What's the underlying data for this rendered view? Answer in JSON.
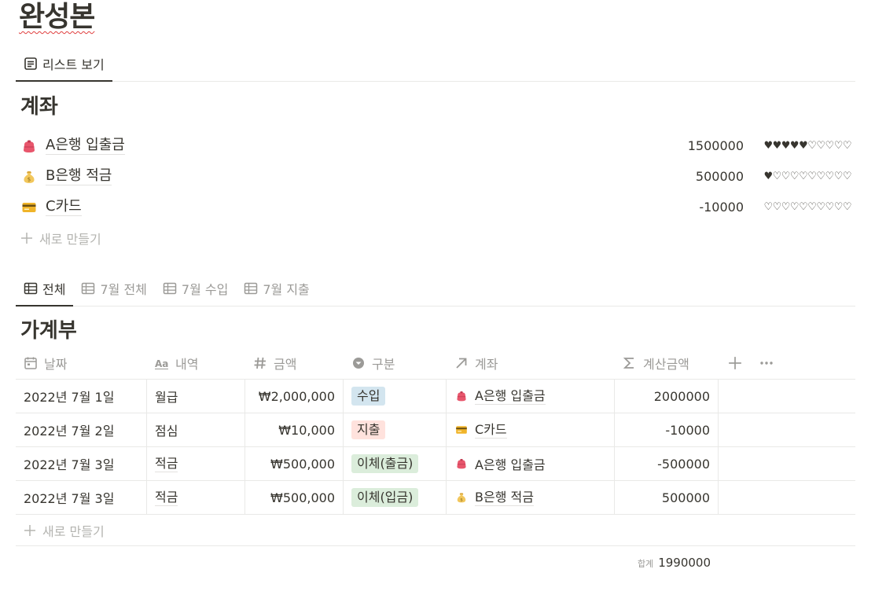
{
  "page": {
    "title": "완성본"
  },
  "top_tabs": [
    {
      "label": "리스트 보기",
      "icon": "list-view-icon",
      "active": true
    }
  ],
  "accounts_section": {
    "title": "계좌",
    "items": [
      {
        "icon": "purse-icon",
        "name": "A은행 입출금",
        "amount": "1500000",
        "hearts": "♥♥♥♥♥♡♡♡♡♡"
      },
      {
        "icon": "money-bag-icon",
        "name": "B은행 적금",
        "amount": "500000",
        "hearts": "♥♡♡♡♡♡♡♡♡♡"
      },
      {
        "icon": "credit-card-icon",
        "name": "C카드",
        "amount": "-10000",
        "hearts": "♡♡♡♡♡♡♡♡♡♡"
      }
    ],
    "new_label": "새로 만들기"
  },
  "view_tabs": [
    {
      "label": "전체",
      "active": true
    },
    {
      "label": "7월 전체",
      "active": false
    },
    {
      "label": "7월 수입",
      "active": false
    },
    {
      "label": "7월 지출",
      "active": false
    }
  ],
  "ledger": {
    "title": "가계부",
    "columns": [
      {
        "label": "날짜",
        "icon": "calendar-icon"
      },
      {
        "label": "내역",
        "icon": "text-icon"
      },
      {
        "label": "금액",
        "icon": "number-icon"
      },
      {
        "label": "구분",
        "icon": "select-icon"
      },
      {
        "label": "계좌",
        "icon": "relation-icon"
      },
      {
        "label": "계산금액",
        "icon": "formula-icon"
      }
    ],
    "rows": [
      {
        "date": "2022년 7월 1일",
        "item": "월급",
        "amount": "₩2,000,000",
        "category": "수입",
        "category_bg": "#d3e5ef",
        "account": "A은행 입출금",
        "account_icon": "purse-icon",
        "calc": "2000000"
      },
      {
        "date": "2022년 7월 2일",
        "item": "점심",
        "amount": "₩10,000",
        "category": "지출",
        "category_bg": "#ffe2dd",
        "account": "C카드",
        "account_icon": "credit-card-icon",
        "calc": "-10000"
      },
      {
        "date": "2022년 7월 3일",
        "item": "적금",
        "amount": "₩500,000",
        "category": "이체(출금)",
        "category_bg": "#dbeddb",
        "account": "A은행 입출금",
        "account_icon": "purse-icon",
        "calc": "-500000"
      },
      {
        "date": "2022년 7월 3일",
        "item": "적금",
        "amount": "₩500,000",
        "category": "이체(입금)",
        "category_bg": "#dbeddb",
        "account": "B은행 적금",
        "account_icon": "money-bag-icon",
        "calc": "500000"
      }
    ],
    "new_label": "새로 만들기",
    "summary": {
      "label": "합계",
      "value": "1990000"
    }
  }
}
